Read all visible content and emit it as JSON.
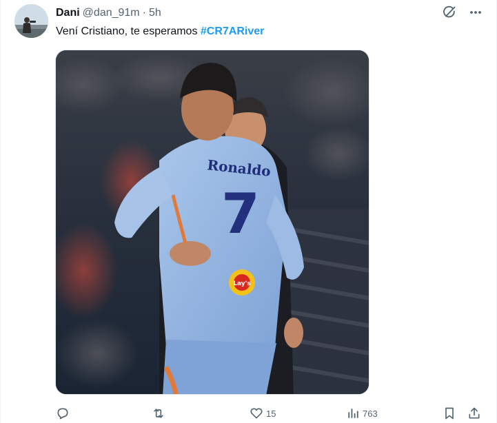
{
  "tweet": {
    "author": {
      "display_name": "Dani",
      "handle": "@dan_91m",
      "separator": "·",
      "time": "5h"
    },
    "text": {
      "body": "Vení Cristiano, te esperamos ",
      "hashtag": "#CR7ARiver"
    },
    "media": {
      "jersey_name": "Ronaldo",
      "jersey_number": "7",
      "sponsor": "Lay's"
    },
    "top_icons": [
      "grok-icon",
      "more-icon"
    ],
    "actions": {
      "reply_count": "",
      "retweet_count": "",
      "like_count": "15",
      "views_count": "763"
    }
  },
  "colors": {
    "link": "#1d9bf0",
    "secondary_text": "#536471",
    "primary_text": "#0f1419"
  }
}
